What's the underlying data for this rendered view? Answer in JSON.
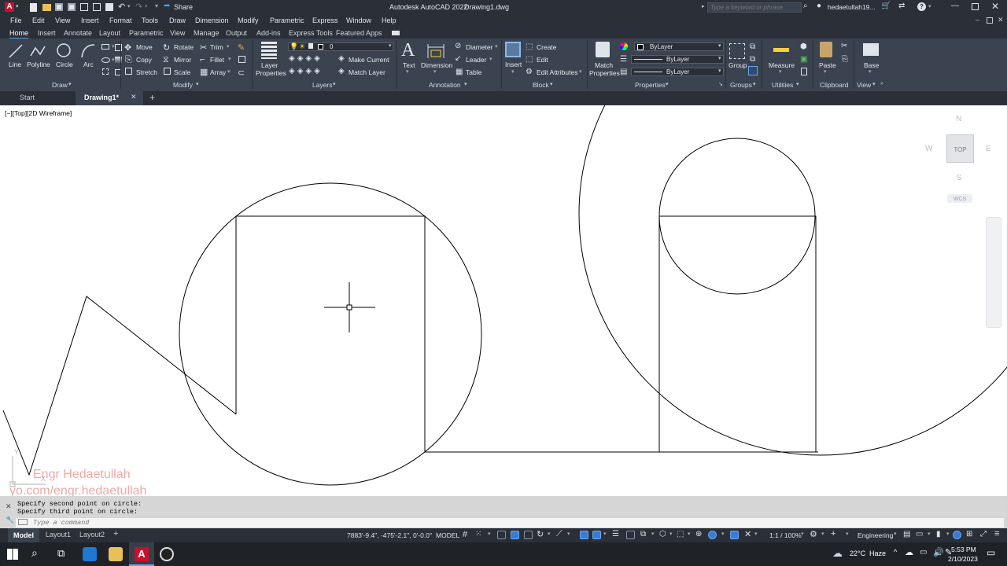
{
  "title_bar": {
    "app_name": "Autodesk AutoCAD 2022",
    "file_name": "Drawing1.dwg",
    "share_label": "Share",
    "search_placeholder": "Type a keyword or phrase",
    "user_name": "hedaetullah19..."
  },
  "menu": {
    "items": [
      "File",
      "Edit",
      "View",
      "Insert",
      "Format",
      "Tools",
      "Draw",
      "Dimension",
      "Modify",
      "Parametric",
      "Express",
      "Window",
      "Help"
    ]
  },
  "ribbon_tabs": {
    "items": [
      "Home",
      "Insert",
      "Annotate",
      "Layout",
      "Parametric",
      "View",
      "Manage",
      "Output",
      "Add-ins",
      "Express Tools",
      "Featured Apps"
    ],
    "active": "Home"
  },
  "ribbon": {
    "draw": {
      "title": "Draw",
      "line": "Line",
      "polyline": "Polyline",
      "circle": "Circle",
      "arc": "Arc"
    },
    "modify": {
      "title": "Modify",
      "move": "Move",
      "rotate": "Rotate",
      "trim": "Trim",
      "copy": "Copy",
      "mirror": "Mirror",
      "fillet": "Fillet",
      "stretch": "Stretch",
      "scale": "Scale",
      "array": "Array"
    },
    "layers": {
      "title": "Layers",
      "layer_properties_1": "Layer",
      "layer_properties_2": "Properties",
      "current_layer": "0",
      "make_current": "Make Current",
      "match_layer": "Match Layer"
    },
    "annotation": {
      "title": "Annotation",
      "text": "Text",
      "dimension": "Dimension",
      "diameter": "Diameter",
      "leader": "Leader",
      "table": "Table"
    },
    "block": {
      "title": "Block",
      "insert": "Insert",
      "create": "Create",
      "edit": "Edit",
      "edit_attributes": "Edit Attributes"
    },
    "properties": {
      "title": "Properties",
      "match_1": "Match",
      "match_2": "Properties",
      "color": "ByLayer",
      "linetype": "ByLayer",
      "lineweight": "ByLayer"
    },
    "groups": {
      "title": "Groups",
      "group": "Group"
    },
    "utilities": {
      "title": "Utilities",
      "measure": "Measure"
    },
    "clipboard": {
      "title": "Clipboard",
      "paste": "Paste"
    },
    "view": {
      "title": "View",
      "base": "Base"
    }
  },
  "file_tabs": {
    "start": "Start",
    "drawing": "Drawing1*"
  },
  "viewport": {
    "label": "[−][Top][2D Wireframe]",
    "viewcube": {
      "top": "TOP",
      "n": "N",
      "s": "S",
      "e": "E",
      "w": "W",
      "wcs": "WCS"
    },
    "watermark_1": "Engr Hedaetullah",
    "watermark_2": "yo.com/engr.hedaetullah",
    "ucs_y": "Y",
    "ucs_x": "X"
  },
  "command": {
    "history": [
      "Specify second point on circle:",
      "Specify third point on circle:"
    ],
    "placeholder": "Type a command"
  },
  "layout_tabs": {
    "model": "Model",
    "layout1": "Layout1",
    "layout2": "Layout2"
  },
  "status": {
    "coords": "7883'-9.4\", -475'-2.1\", 0'-0.0\"",
    "model": "MODEL",
    "scale": "1:1 / 100%",
    "workspace": "Engineering"
  },
  "taskbar": {
    "weather_temp": "22°C",
    "weather_desc": "Haze",
    "time": "5:53 PM",
    "date": "2/10/2023"
  },
  "colors": {
    "accent": "#4a9fe8",
    "autocad_red": "#c8102e",
    "ribbon_bg": "#3b4350",
    "chrome_bg": "#2a2f38"
  }
}
